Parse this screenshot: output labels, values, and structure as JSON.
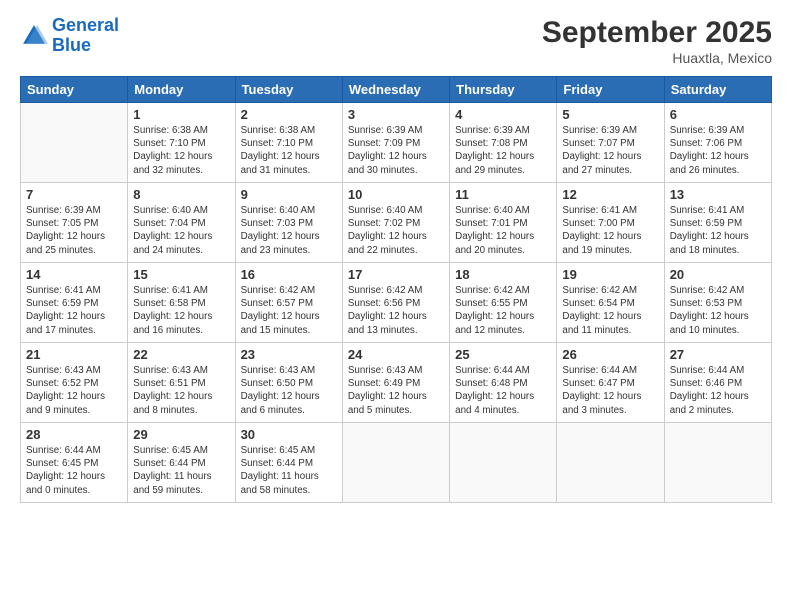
{
  "header": {
    "logo_line1": "General",
    "logo_line2": "Blue",
    "month": "September 2025",
    "location": "Huaxtla, Mexico"
  },
  "weekdays": [
    "Sunday",
    "Monday",
    "Tuesday",
    "Wednesday",
    "Thursday",
    "Friday",
    "Saturday"
  ],
  "weeks": [
    [
      {
        "day": "",
        "info": ""
      },
      {
        "day": "1",
        "info": "Sunrise: 6:38 AM\nSunset: 7:10 PM\nDaylight: 12 hours\nand 32 minutes."
      },
      {
        "day": "2",
        "info": "Sunrise: 6:38 AM\nSunset: 7:10 PM\nDaylight: 12 hours\nand 31 minutes."
      },
      {
        "day": "3",
        "info": "Sunrise: 6:39 AM\nSunset: 7:09 PM\nDaylight: 12 hours\nand 30 minutes."
      },
      {
        "day": "4",
        "info": "Sunrise: 6:39 AM\nSunset: 7:08 PM\nDaylight: 12 hours\nand 29 minutes."
      },
      {
        "day": "5",
        "info": "Sunrise: 6:39 AM\nSunset: 7:07 PM\nDaylight: 12 hours\nand 27 minutes."
      },
      {
        "day": "6",
        "info": "Sunrise: 6:39 AM\nSunset: 7:06 PM\nDaylight: 12 hours\nand 26 minutes."
      }
    ],
    [
      {
        "day": "7",
        "info": "Sunrise: 6:39 AM\nSunset: 7:05 PM\nDaylight: 12 hours\nand 25 minutes."
      },
      {
        "day": "8",
        "info": "Sunrise: 6:40 AM\nSunset: 7:04 PM\nDaylight: 12 hours\nand 24 minutes."
      },
      {
        "day": "9",
        "info": "Sunrise: 6:40 AM\nSunset: 7:03 PM\nDaylight: 12 hours\nand 23 minutes."
      },
      {
        "day": "10",
        "info": "Sunrise: 6:40 AM\nSunset: 7:02 PM\nDaylight: 12 hours\nand 22 minutes."
      },
      {
        "day": "11",
        "info": "Sunrise: 6:40 AM\nSunset: 7:01 PM\nDaylight: 12 hours\nand 20 minutes."
      },
      {
        "day": "12",
        "info": "Sunrise: 6:41 AM\nSunset: 7:00 PM\nDaylight: 12 hours\nand 19 minutes."
      },
      {
        "day": "13",
        "info": "Sunrise: 6:41 AM\nSunset: 6:59 PM\nDaylight: 12 hours\nand 18 minutes."
      }
    ],
    [
      {
        "day": "14",
        "info": "Sunrise: 6:41 AM\nSunset: 6:59 PM\nDaylight: 12 hours\nand 17 minutes."
      },
      {
        "day": "15",
        "info": "Sunrise: 6:41 AM\nSunset: 6:58 PM\nDaylight: 12 hours\nand 16 minutes."
      },
      {
        "day": "16",
        "info": "Sunrise: 6:42 AM\nSunset: 6:57 PM\nDaylight: 12 hours\nand 15 minutes."
      },
      {
        "day": "17",
        "info": "Sunrise: 6:42 AM\nSunset: 6:56 PM\nDaylight: 12 hours\nand 13 minutes."
      },
      {
        "day": "18",
        "info": "Sunrise: 6:42 AM\nSunset: 6:55 PM\nDaylight: 12 hours\nand 12 minutes."
      },
      {
        "day": "19",
        "info": "Sunrise: 6:42 AM\nSunset: 6:54 PM\nDaylight: 12 hours\nand 11 minutes."
      },
      {
        "day": "20",
        "info": "Sunrise: 6:42 AM\nSunset: 6:53 PM\nDaylight: 12 hours\nand 10 minutes."
      }
    ],
    [
      {
        "day": "21",
        "info": "Sunrise: 6:43 AM\nSunset: 6:52 PM\nDaylight: 12 hours\nand 9 minutes."
      },
      {
        "day": "22",
        "info": "Sunrise: 6:43 AM\nSunset: 6:51 PM\nDaylight: 12 hours\nand 8 minutes."
      },
      {
        "day": "23",
        "info": "Sunrise: 6:43 AM\nSunset: 6:50 PM\nDaylight: 12 hours\nand 6 minutes."
      },
      {
        "day": "24",
        "info": "Sunrise: 6:43 AM\nSunset: 6:49 PM\nDaylight: 12 hours\nand 5 minutes."
      },
      {
        "day": "25",
        "info": "Sunrise: 6:44 AM\nSunset: 6:48 PM\nDaylight: 12 hours\nand 4 minutes."
      },
      {
        "day": "26",
        "info": "Sunrise: 6:44 AM\nSunset: 6:47 PM\nDaylight: 12 hours\nand 3 minutes."
      },
      {
        "day": "27",
        "info": "Sunrise: 6:44 AM\nSunset: 6:46 PM\nDaylight: 12 hours\nand 2 minutes."
      }
    ],
    [
      {
        "day": "28",
        "info": "Sunrise: 6:44 AM\nSunset: 6:45 PM\nDaylight: 12 hours\nand 0 minutes."
      },
      {
        "day": "29",
        "info": "Sunrise: 6:45 AM\nSunset: 6:44 PM\nDaylight: 11 hours\nand 59 minutes."
      },
      {
        "day": "30",
        "info": "Sunrise: 6:45 AM\nSunset: 6:44 PM\nDaylight: 11 hours\nand 58 minutes."
      },
      {
        "day": "",
        "info": ""
      },
      {
        "day": "",
        "info": ""
      },
      {
        "day": "",
        "info": ""
      },
      {
        "day": "",
        "info": ""
      }
    ]
  ]
}
